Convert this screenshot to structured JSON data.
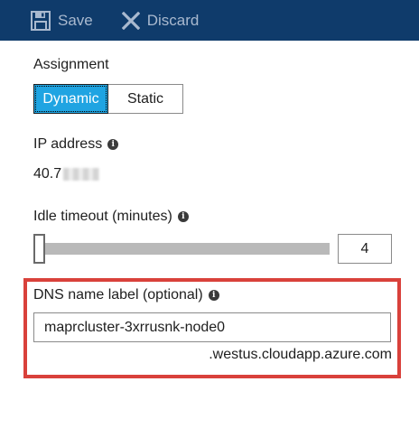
{
  "toolbar": {
    "save_label": "Save",
    "discard_label": "Discard"
  },
  "assignment": {
    "label": "Assignment",
    "options": [
      "Dynamic",
      "Static"
    ],
    "selected": "Dynamic"
  },
  "ip_address": {
    "label": "IP address",
    "value_visible": "40.7"
  },
  "idle_timeout": {
    "label": "Idle timeout (minutes)",
    "value": "4"
  },
  "dns": {
    "label": "DNS name label (optional)",
    "value": "maprcluster-3xrrusnk-node0",
    "suffix": ".westus.cloudapp.azure.com"
  },
  "colors": {
    "toolbar_bg": "#0f3b6b",
    "toolbar_text": "#a9b9cf",
    "active_blue": "#1fa4e2",
    "highlight_red": "#d9413b"
  },
  "icons": {
    "save": "floppy-disk-icon",
    "discard": "x-icon",
    "info": "info-icon"
  }
}
